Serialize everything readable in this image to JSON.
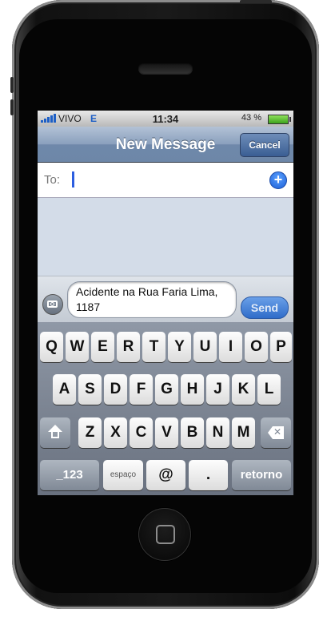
{
  "status": {
    "carrier": "VIVO",
    "network": "E",
    "time": "11:34",
    "battery": "43 %"
  },
  "navbar": {
    "title": "New Message",
    "cancel": "Cancel"
  },
  "to": {
    "label": "To:"
  },
  "compose": {
    "message": "Acidente na Rua Faria Lima, 1187",
    "send": "Send"
  },
  "keyboard": {
    "row1": [
      "Q",
      "W",
      "E",
      "R",
      "T",
      "Y",
      "U",
      "I",
      "O",
      "P"
    ],
    "row2": [
      "A",
      "S",
      "D",
      "F",
      "G",
      "H",
      "J",
      "K",
      "L"
    ],
    "row3": [
      "Z",
      "X",
      "C",
      "V",
      "B",
      "N",
      "M"
    ],
    "numbers": "_123",
    "space": "espaço",
    "at": "@",
    "dot": ".",
    "return": "retorno"
  },
  "colors": {
    "accent": "#2c5ee0",
    "navbar": "#6f88aa",
    "send": "#2f6cc9"
  }
}
